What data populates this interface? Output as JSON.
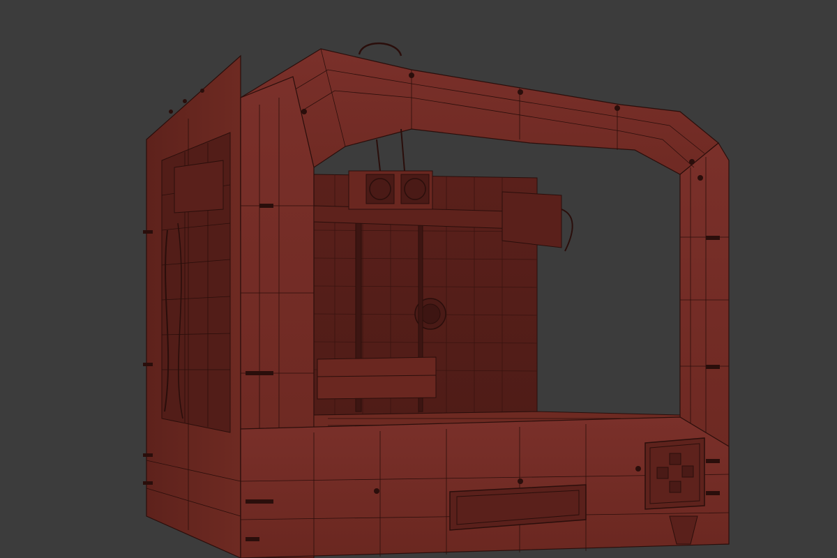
{
  "scene": {
    "subject": "3d-printer-wireframe-model",
    "background_color": "#3c3c3c",
    "mesh_fill_color": "#6e2a22",
    "mesh_fill_light": "#7a302a",
    "mesh_fill_dark": "#4a1a16",
    "wire_color": "#2a0e0b",
    "render_mode": "wireframe-on-shaded"
  }
}
